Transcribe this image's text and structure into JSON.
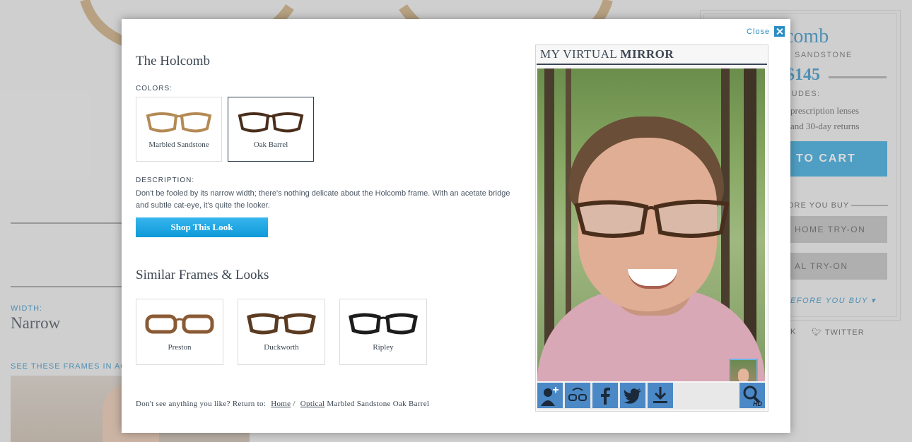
{
  "background": {
    "width_label": "WIDTH:",
    "width_value": "Narrow",
    "see_frames": "SEE THESE FRAMES IN ACT",
    "title_fragment": "comb",
    "color_fragment": "D SANDSTONE",
    "price_fragment": "145",
    "includes_fragment": "LUDES:",
    "include_lines": [
      "prescription lenses",
      "and 30-day returns"
    ],
    "cart_fragment": "TO CART",
    "before_fragment": "ORE YOU BUY",
    "home_tryon_fragment": "HOME TRY-ON",
    "virtual_tryon_fragment": "AL TRY-ON",
    "learn_fragment": "EFORE YOU BUY ▾",
    "facebook_fragment": "K",
    "twitter_label": "TWITTER"
  },
  "modal": {
    "close_label": "Close",
    "title": "The Holcomb",
    "colors_label": "COLORS:",
    "colors": [
      {
        "name": "Marbled Sandstone",
        "selected": false,
        "frame_color": "#b48a55"
      },
      {
        "name": "Oak Barrel",
        "selected": true,
        "frame_color": "#4a2e1c"
      }
    ],
    "description_label": "DESCRIPTION:",
    "description": "Don't be fooled by its narrow width; there's nothing delicate about the Holcomb frame. With an acetate bridge and subtle cat-eye, it's quite the looker.",
    "shop_button": "Shop This Look",
    "similar_title": "Similar Frames & Looks",
    "similar": [
      {
        "name": "Preston",
        "frame_color": "#8a5a34"
      },
      {
        "name": "Duckworth",
        "frame_color": "#5a3b22"
      },
      {
        "name": "Ripley",
        "frame_color": "#1c1c1c"
      }
    ],
    "footer_prefix": "Don't see anything you like? Return to:",
    "footer_home": "Home",
    "footer_separator": "/",
    "footer_optical": "Optical",
    "footer_suffix": "Marbled Sandstone Oak Barrel"
  },
  "mirror": {
    "title_light": "MY VIRTUAL",
    "title_bold": "MIRROR",
    "tools": [
      "add-user-icon",
      "rotate-glasses-icon",
      "facebook-icon",
      "twitter-icon",
      "download-icon"
    ],
    "hd_label": "HD"
  },
  "colors": {
    "accent": "#2a8cc4",
    "button_blue": "#1fa5e2",
    "toolbar_blue": "#4b88c6"
  }
}
